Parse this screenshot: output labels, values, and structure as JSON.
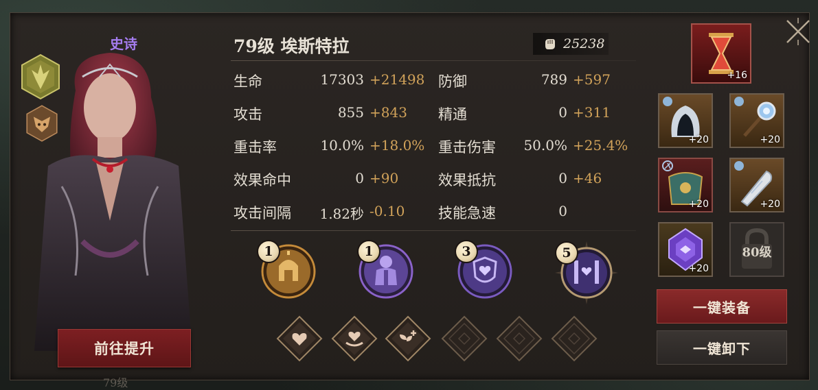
{
  "hero": {
    "rarity": "史诗",
    "title": "79级 埃斯特拉",
    "power": "25238",
    "upgrade_label": "前往提升",
    "ghost_level": "79级"
  },
  "stats": [
    {
      "label": "生命",
      "base": "17303",
      "bonus": "+21498"
    },
    {
      "label": "防御",
      "base": "789",
      "bonus": "+597"
    },
    {
      "label": "攻击",
      "base": "855",
      "bonus": "+843"
    },
    {
      "label": "精通",
      "base": "0",
      "bonus": "+311"
    },
    {
      "label": "重击率",
      "base": "10.0%",
      "bonus": "+18.0%"
    },
    {
      "label": "重击伤害",
      "base": "50.0%",
      "bonus": "+25.4%"
    },
    {
      "label": "效果命中",
      "base": "0",
      "bonus": "+90"
    },
    {
      "label": "效果抵抗",
      "base": "0",
      "bonus": "+46"
    },
    {
      "label": "攻击间隔",
      "base": "1.82秒",
      "bonus": "-0.10"
    },
    {
      "label": "技能急速",
      "base": "0",
      "bonus": ""
    }
  ],
  "skills": [
    {
      "level": "1",
      "icon": "spartan-helmet-icon",
      "color": "#c58b3a"
    },
    {
      "level": "1",
      "icon": "knight-armor-icon",
      "color": "#8a62c9"
    },
    {
      "level": "3",
      "icon": "heart-shield-icon",
      "color": "#7a5bc0"
    },
    {
      "level": "5",
      "icon": "heart-gate-icon",
      "color": "#6b52b8"
    }
  ],
  "runes": [
    {
      "icon": "heart-icon",
      "active": true
    },
    {
      "icon": "heart-hand-icon",
      "active": true
    },
    {
      "icon": "sprout-plus-icon",
      "active": true
    },
    {
      "icon": "empty-rune-icon",
      "active": false
    },
    {
      "icon": "empty-rune-icon",
      "active": false
    },
    {
      "icon": "empty-rune-icon",
      "active": false
    }
  ],
  "equipment": {
    "hourglass_level": "+16",
    "helmet_level": "+20",
    "scepter_level": "+20",
    "armor_level": "+20",
    "bracer_level": "+20",
    "gem_level": "+20",
    "locked_label": "80级"
  },
  "buttons": {
    "equip_all": "一键装备",
    "unequip_all": "一键卸下"
  },
  "colors": {
    "bonus": "#d2a35a",
    "rarity_epic": "#a57df0",
    "primary_button": "#7d1f22"
  }
}
